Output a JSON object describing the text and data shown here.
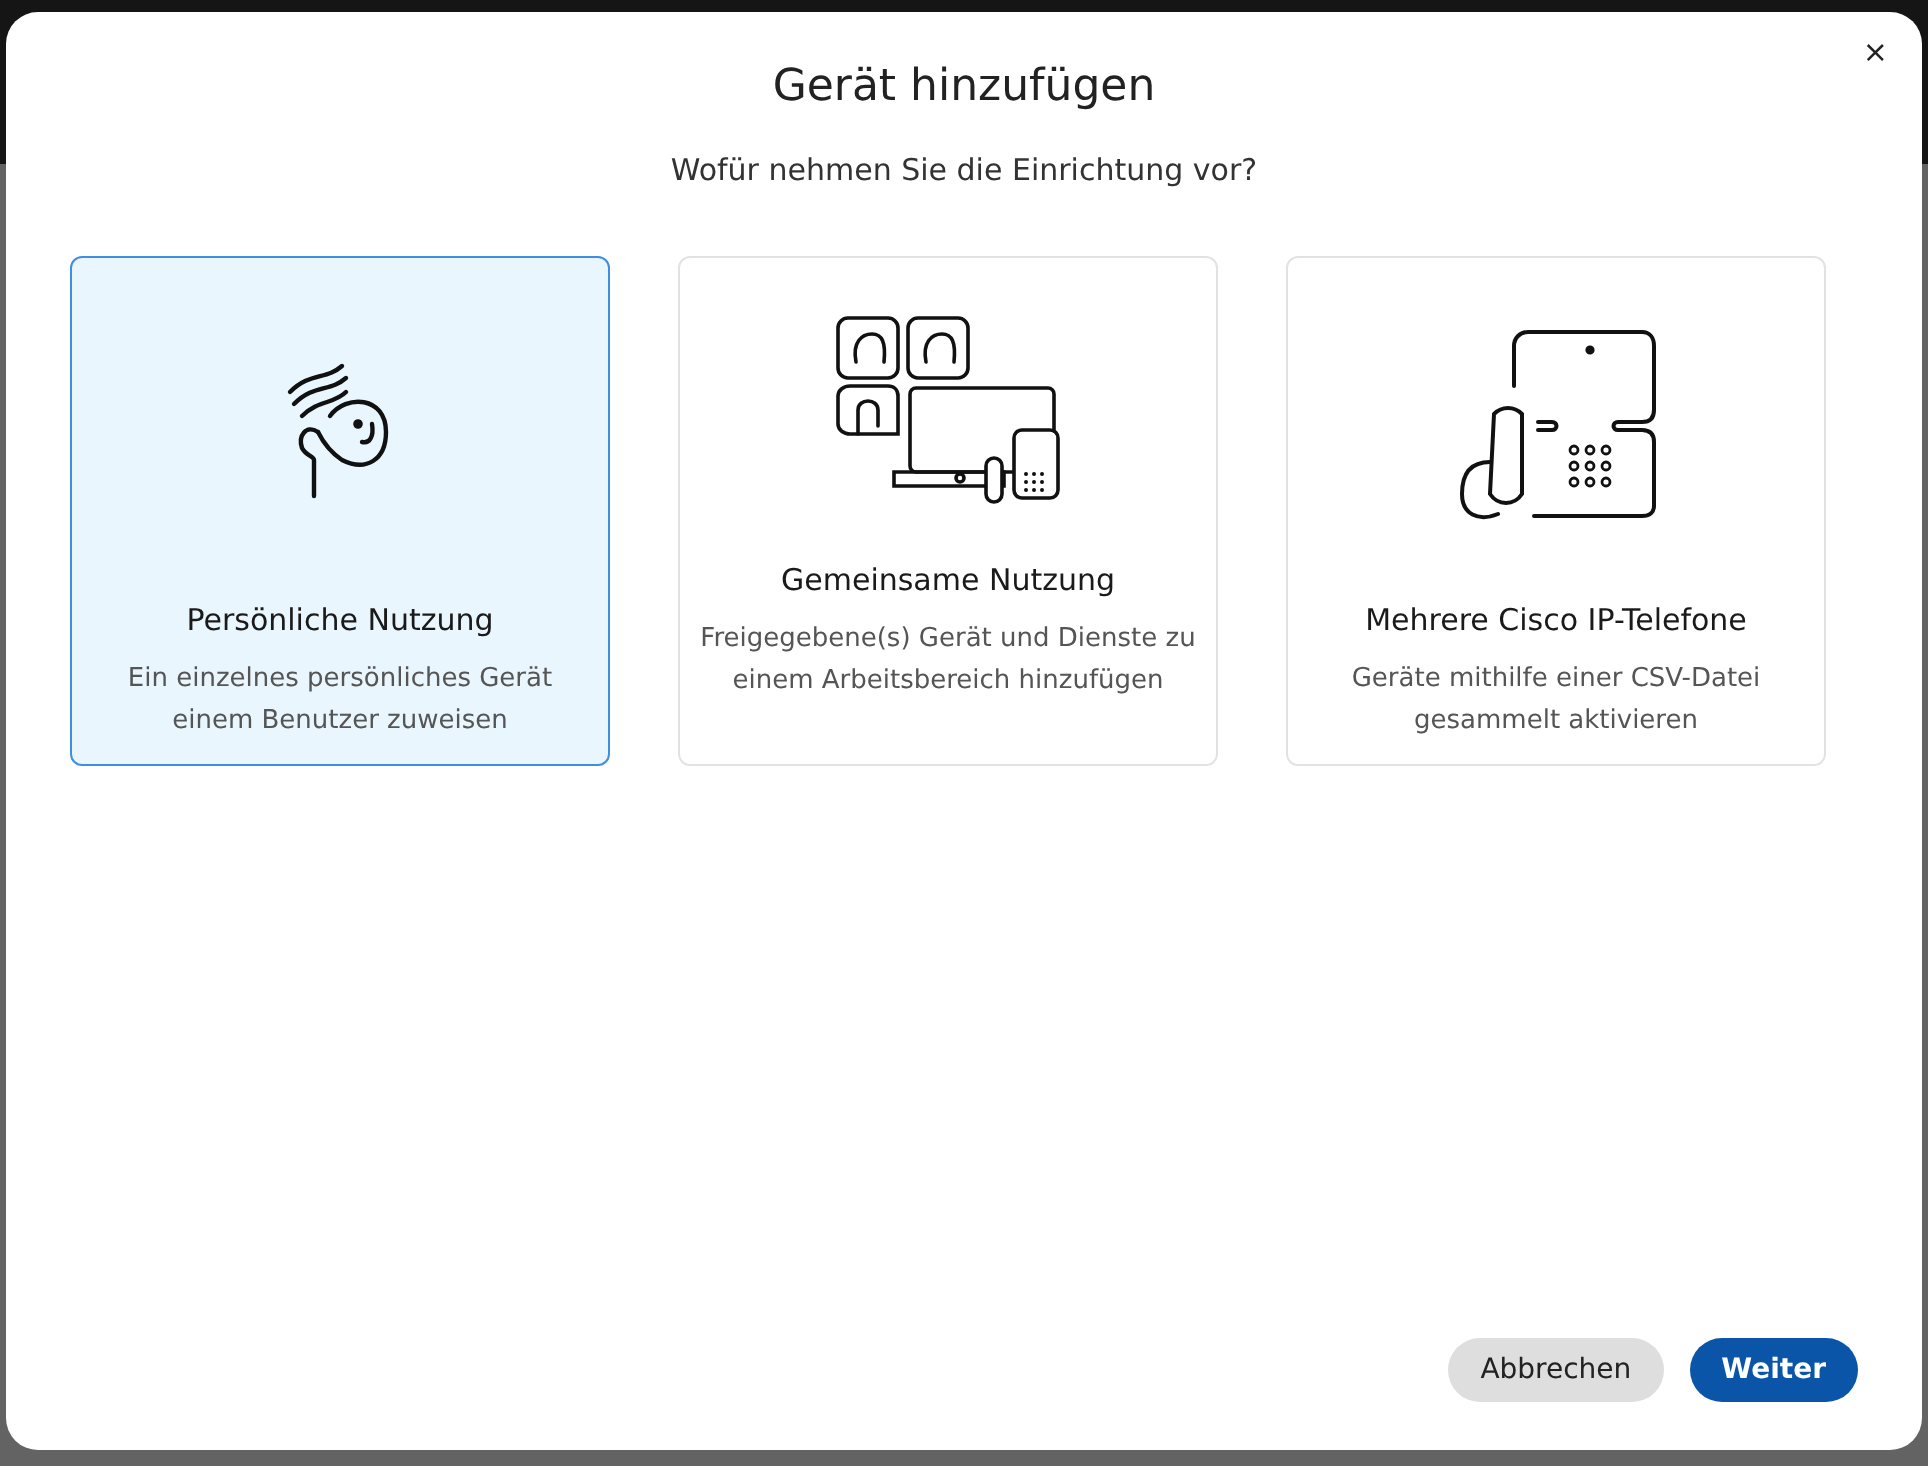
{
  "dialog": {
    "title": "Gerät hinzufügen",
    "subtitle": "Wofür nehmen Sie die Einrichtung vor?",
    "close": "×"
  },
  "options": [
    {
      "kind": "personal",
      "title": "Persönliche Nutzung",
      "description": "Ein einzelnes persönliches Gerät einem Benutzer zuweisen",
      "selected": true
    },
    {
      "kind": "shared",
      "title": "Gemeinsame Nutzung",
      "description": "Freigegebene(s) Gerät und Dienste zu einem Arbeitsbereich hinzufügen",
      "selected": false
    },
    {
      "kind": "phones",
      "title": "Mehrere Cisco IP-Telefone",
      "description": "Geräte mithilfe einer CSV-Datei gesammelt aktivieren",
      "selected": false
    }
  ],
  "buttons": [
    {
      "label": "Abbrechen",
      "kind": "secondary"
    },
    {
      "label": "Weiter",
      "kind": "primary"
    }
  ]
}
